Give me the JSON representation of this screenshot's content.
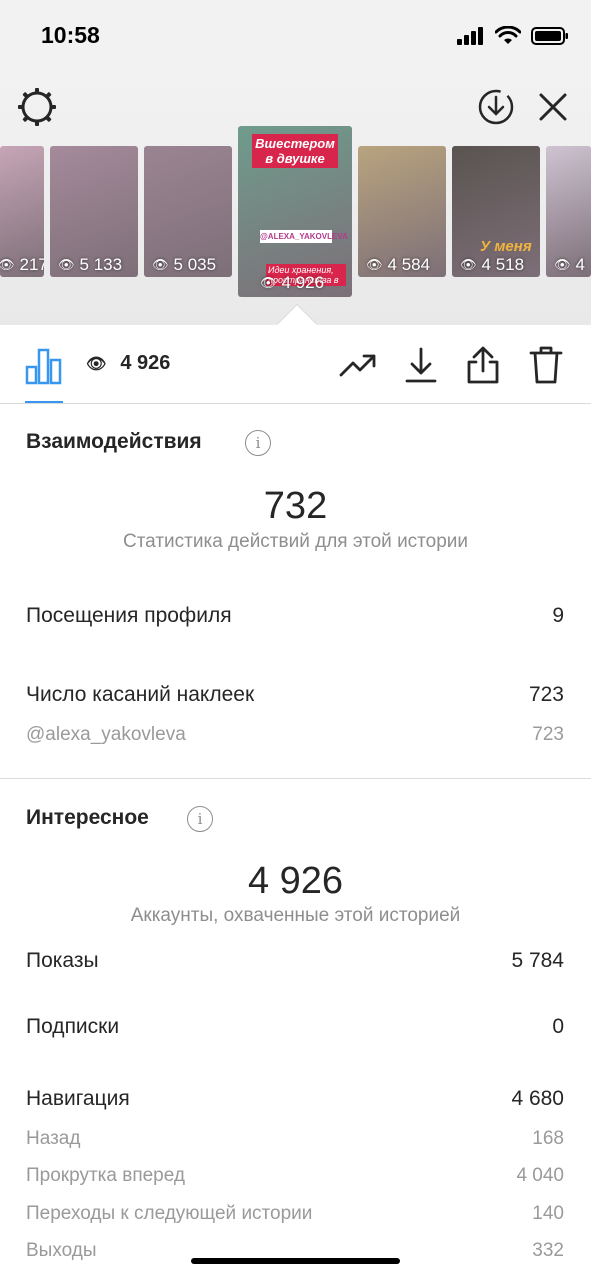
{
  "status": {
    "time": "10:58"
  },
  "thumbnails": [
    {
      "views": "217",
      "bg": "#c6a5b6"
    },
    {
      "views": "5 133",
      "bg": "#a58a9b"
    },
    {
      "views": "5 035",
      "bg": "#9b8492"
    },
    {
      "views": "4 926",
      "bg": "#6f9c8c",
      "headline": "Вшестером в двушке",
      "tag": "@ALEXA_YAKOVLEVA",
      "caption": "Идеи хранения, пространства в"
    },
    {
      "views": "4 584",
      "bg": "#b9a47e"
    },
    {
      "views": "4 518",
      "bg": "#5a5350",
      "headline": "У меня"
    },
    {
      "views": "4",
      "bg": "#cfc3d2"
    }
  ],
  "toolbar": {
    "views": "4 926"
  },
  "interactions": {
    "title": "Взаимодействия",
    "total": "732",
    "caption": "Статистика действий для этой истории",
    "rows": [
      {
        "label": "Посещения профиля",
        "value": "9"
      },
      {
        "label": "Число касаний наклеек",
        "value": "723"
      }
    ],
    "sub_rows": [
      {
        "label": "@alexa_yakovleva",
        "value": "723"
      }
    ]
  },
  "discovery": {
    "title": "Интересное",
    "total": "4 926",
    "caption": "Аккаунты, охваченные этой историей",
    "rows": [
      {
        "label": "Показы",
        "value": "5 784"
      },
      {
        "label": "Подписки",
        "value": "0"
      },
      {
        "label": "Навигация",
        "value": "4 680"
      }
    ],
    "navigation": [
      {
        "label": "Назад",
        "value": "168"
      },
      {
        "label": "Прокрутка вперед",
        "value": "4 040"
      },
      {
        "label": "Переходы к следующей истории",
        "value": "140"
      },
      {
        "label": "Выходы",
        "value": "332"
      }
    ]
  },
  "colors": {
    "accent": "#3797f0",
    "text": "#262626",
    "secondary": "#8e8e8e"
  }
}
